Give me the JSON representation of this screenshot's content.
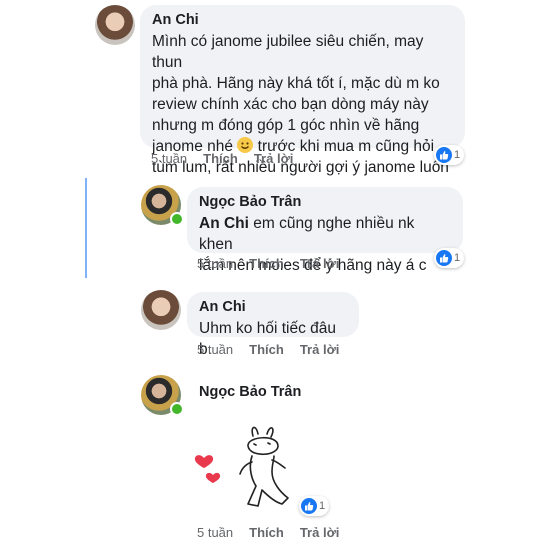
{
  "comments": [
    {
      "author": "An Chi",
      "lines": [
        "Mình có janome jubilee siêu chiến, may thun",
        "phà phà. Hãng này khá tốt í, mặc dù m ko",
        "review chính xác cho bạn dòng máy này",
        "nhưng m đóng góp 1 góc nhìn về hãng",
        "janome nhé",
        "trước khi mua m cũng hỏi",
        "tùm lum, rất nhiều người gợi ý janome luôn"
      ],
      "time": "5 tuần",
      "like_label": "Thích",
      "reply_label": "Trả lời",
      "reaction_count": "1"
    },
    {
      "author": "Ngọc Bảo Trân",
      "tag": "An Chi",
      "lines": [
        "em cũng nghe nhiều nk khen",
        "lắm nên moies để ý hãng này á c"
      ],
      "time": "5 tuần",
      "like_label": "Thích",
      "reply_label": "Trả lời",
      "reaction_count": "1"
    },
    {
      "author": "An Chi",
      "lines": [
        "Uhm ko hối tiếc đâu b."
      ],
      "time": "5 tuần",
      "like_label": "Thích",
      "reply_label": "Trả lời"
    },
    {
      "author": "Ngọc Bảo Trân",
      "sticker": "bunny-hearts-sticker",
      "time": "5 tuần",
      "like_label": "Thích",
      "reply_label": "Trả lời",
      "reaction_count": "1"
    }
  ],
  "icons": {
    "like_reaction": "like-icon",
    "emoji": "smile-emoji-icon",
    "sticker": "bunny-hearts-sticker"
  },
  "colors": {
    "bubble": "#f0f2f5",
    "like_blue": "#1877f2",
    "meta_text": "#65676b",
    "heart": "#e8394d",
    "online": "#42b72a"
  }
}
